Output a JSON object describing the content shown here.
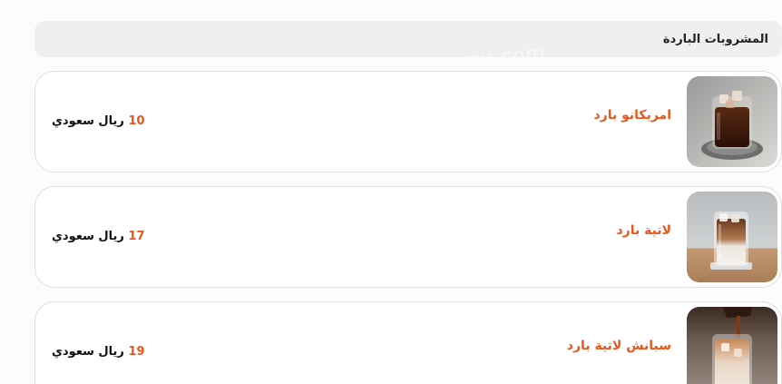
{
  "section": {
    "title": "المشروبات الباردة"
  },
  "watermark": "···nu.com",
  "items": [
    {
      "name": "امريكانو بارد",
      "price": "10",
      "currency": "ريال سعودي",
      "image": "iced-americano-photo"
    },
    {
      "name": "لاتية بارد",
      "price": "17",
      "currency": "ريال سعودي",
      "image": "iced-latte-photo"
    },
    {
      "name": "سبانش لاتية بارد",
      "price": "19",
      "currency": "ريال سعودي",
      "image": "iced-spanish-latte-photo"
    }
  ],
  "colors": {
    "accent": "#e8561c",
    "header_bg": "#efefef",
    "card_border": "#dedede"
  }
}
